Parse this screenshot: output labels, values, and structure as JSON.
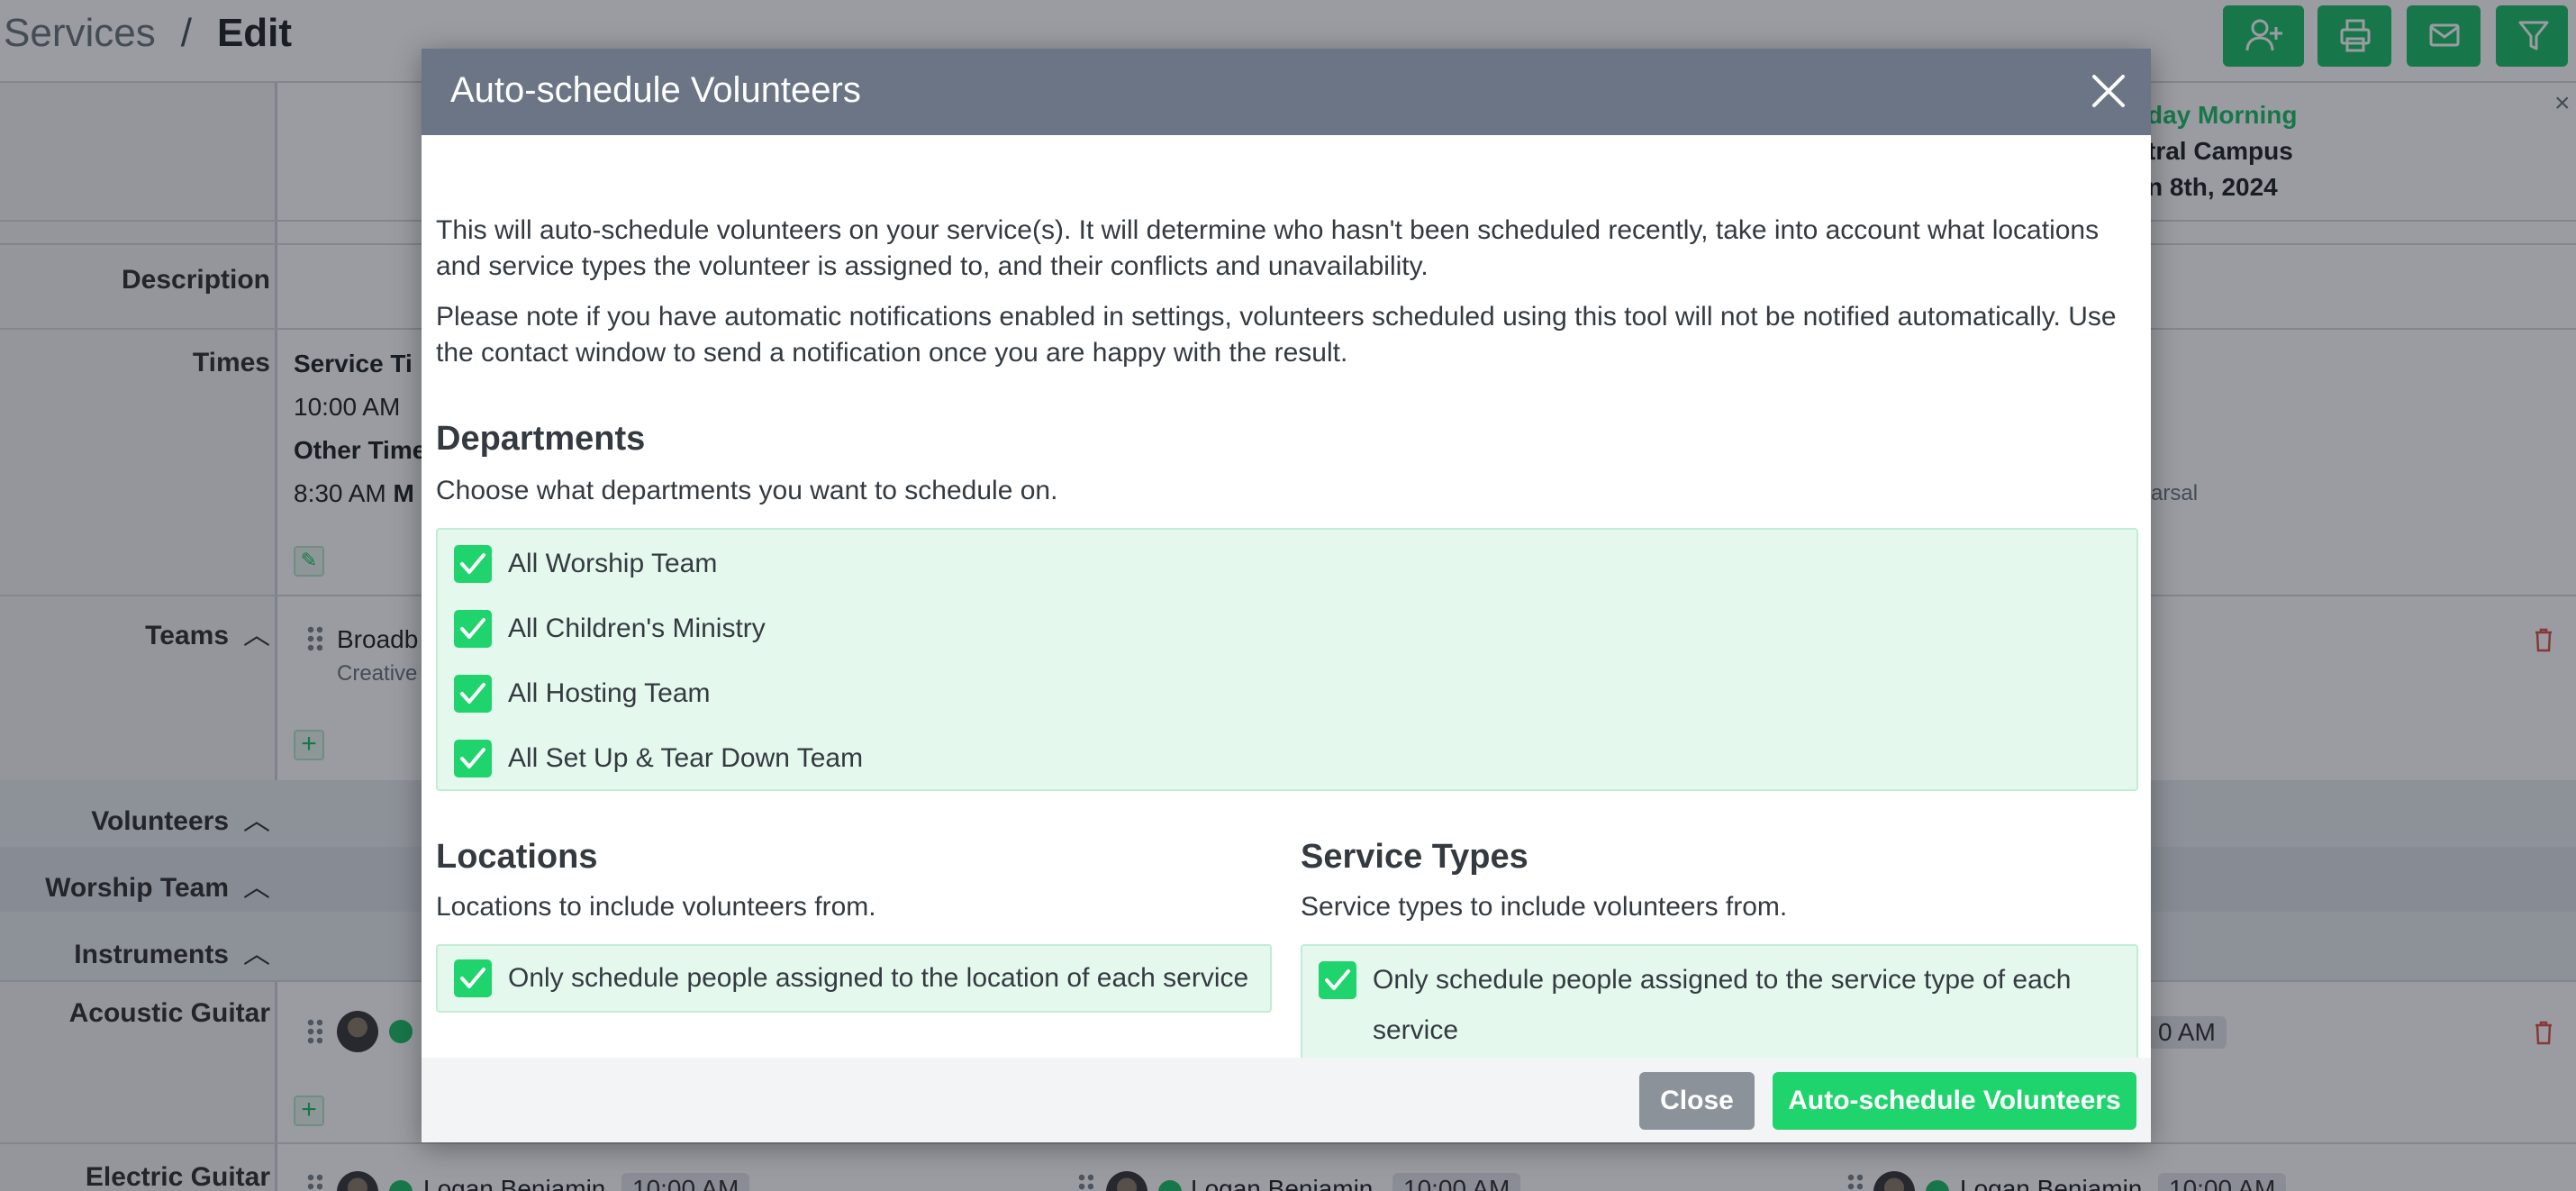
{
  "breadcrumb": {
    "parent": "Services",
    "separator": "/",
    "current": "Edit"
  },
  "background": {
    "service_header": {
      "line1": "day Morning",
      "line2": "tral Campus",
      "line3": "n 8th, 2024"
    },
    "rows": {
      "description": "Description",
      "times": "Times",
      "teams": "Teams",
      "volunteers": "Volunteers",
      "worship_team": "Worship Team",
      "instruments": "Instruments",
      "acoustic_guitar": "Acoustic Guitar",
      "electric_guitar": "Electric Guitar"
    },
    "times": {
      "service_time_label": "Service Ti",
      "service_time": "10:00 AM",
      "other_time_label": "Other Time",
      "other_time": "8:30 AM",
      "other_time_suffix": "M",
      "rehearsal_fragment": "arsal"
    },
    "teams": {
      "team_name": "Broadb",
      "team_sub": "Creative"
    },
    "acoustic_time_fragment": "0 AM",
    "electric_names": [
      "Logan Benjamin",
      "Logan Benjamin",
      "Logan Benjamin"
    ],
    "electric_time": "10:00 AM"
  },
  "modal": {
    "title": "Auto-schedule Volunteers",
    "intro1": "This will auto-schedule volunteers on your service(s). It will determine who hasn't been scheduled recently, take into account what locations and service types the volunteer is assigned to, and their conflicts and unavailability.",
    "intro2": "Please note if you have automatic notifications enabled in settings, volunteers scheduled using this tool will not be notified automatically. Use the contact window to send a notification once you are happy with the result.",
    "departments": {
      "heading": "Departments",
      "subtitle": "Choose what departments you want to schedule on.",
      "items": [
        "All Worship Team",
        "All Children's Ministry",
        "All Hosting Team",
        "All Set Up & Tear Down Team"
      ]
    },
    "locations": {
      "heading": "Locations",
      "subtitle": "Locations to include volunteers from.",
      "option": "Only schedule people assigned to the location of each service"
    },
    "service_types": {
      "heading": "Service Types",
      "subtitle": "Service types to include volunteers from.",
      "option": "Only schedule people assigned to the service type of each service"
    },
    "buttons": {
      "close": "Close",
      "submit": "Auto-schedule Volunteers"
    }
  },
  "colors": {
    "accent": "#1fd46c",
    "header": "#6b7585",
    "panel": "#e4f8ee"
  }
}
